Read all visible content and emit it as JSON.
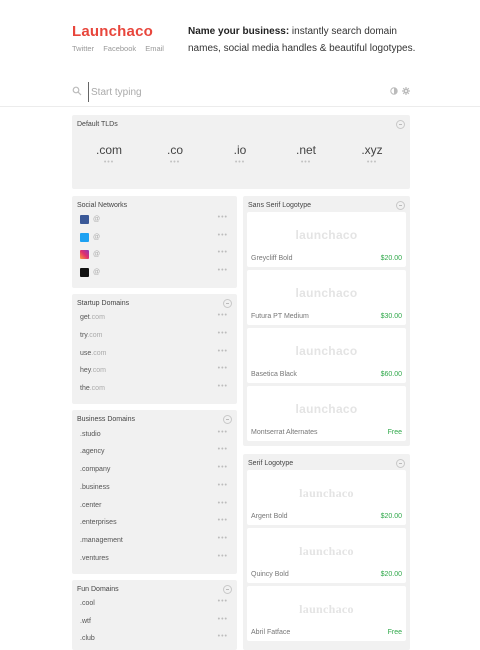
{
  "brand": {
    "name": "Launchaco",
    "color": "#e8463c"
  },
  "header_links": [
    "Twitter",
    "Facebook",
    "Email"
  ],
  "tagline": {
    "bold": "Name your business:",
    "rest": " instantly search domain names, social media handles & beautiful logotypes."
  },
  "search": {
    "placeholder": "Start typing"
  },
  "tlds": {
    "title": "Default TLDs",
    "items": [
      ".com",
      ".co",
      ".io",
      ".net",
      ".xyz"
    ],
    "dots": "•••"
  },
  "social": {
    "title": "Social Networks",
    "items": [
      {
        "icon": "facebook-icon",
        "color": "#3b5998",
        "at": "@"
      },
      {
        "icon": "twitter-icon",
        "color": "#1da1f2",
        "at": "@"
      },
      {
        "icon": "instagram-icon",
        "color": "#e1306c",
        "at": "@"
      },
      {
        "icon": "medium-icon",
        "color": "#111111",
        "at": "@"
      }
    ]
  },
  "startup": {
    "title": "Startup Domains",
    "items": [
      {
        "prefix": "get",
        "suffix": ".com"
      },
      {
        "prefix": "try",
        "suffix": ".com"
      },
      {
        "prefix": "use",
        "suffix": ".com"
      },
      {
        "prefix": "hey",
        "suffix": ".com"
      },
      {
        "prefix": "the",
        "suffix": ".com"
      }
    ]
  },
  "business": {
    "title": "Business Domains",
    "items": [
      ".studio",
      ".agency",
      ".company",
      ".business",
      ".center",
      ".enterprises",
      ".management",
      ".ventures"
    ]
  },
  "fun": {
    "title": "Fun Domains",
    "items": [
      ".cool",
      ".wtf",
      ".club"
    ]
  },
  "sans_logos": {
    "title": "Sans Serif Logotype",
    "preview": "launchaco",
    "items": [
      {
        "font": "Greycliff Bold",
        "price": "$20.00"
      },
      {
        "font": "Futura PT Medium",
        "price": "$30.00"
      },
      {
        "font": "Basetica Black",
        "price": "$60.00"
      },
      {
        "font": "Montserrat Alternates",
        "price": "Free"
      }
    ]
  },
  "serif_logos": {
    "title": "Serif Logotype",
    "preview": "launchaco",
    "items": [
      {
        "font": "Argent Bold",
        "price": "$20.00"
      },
      {
        "font": "Quincy Bold",
        "price": "$20.00"
      },
      {
        "font": "Abril Fatface",
        "price": "Free"
      }
    ]
  },
  "dots": "•••",
  "colors": {
    "price_green": "#2fa84a",
    "panel_bg": "#f1f1f1"
  }
}
